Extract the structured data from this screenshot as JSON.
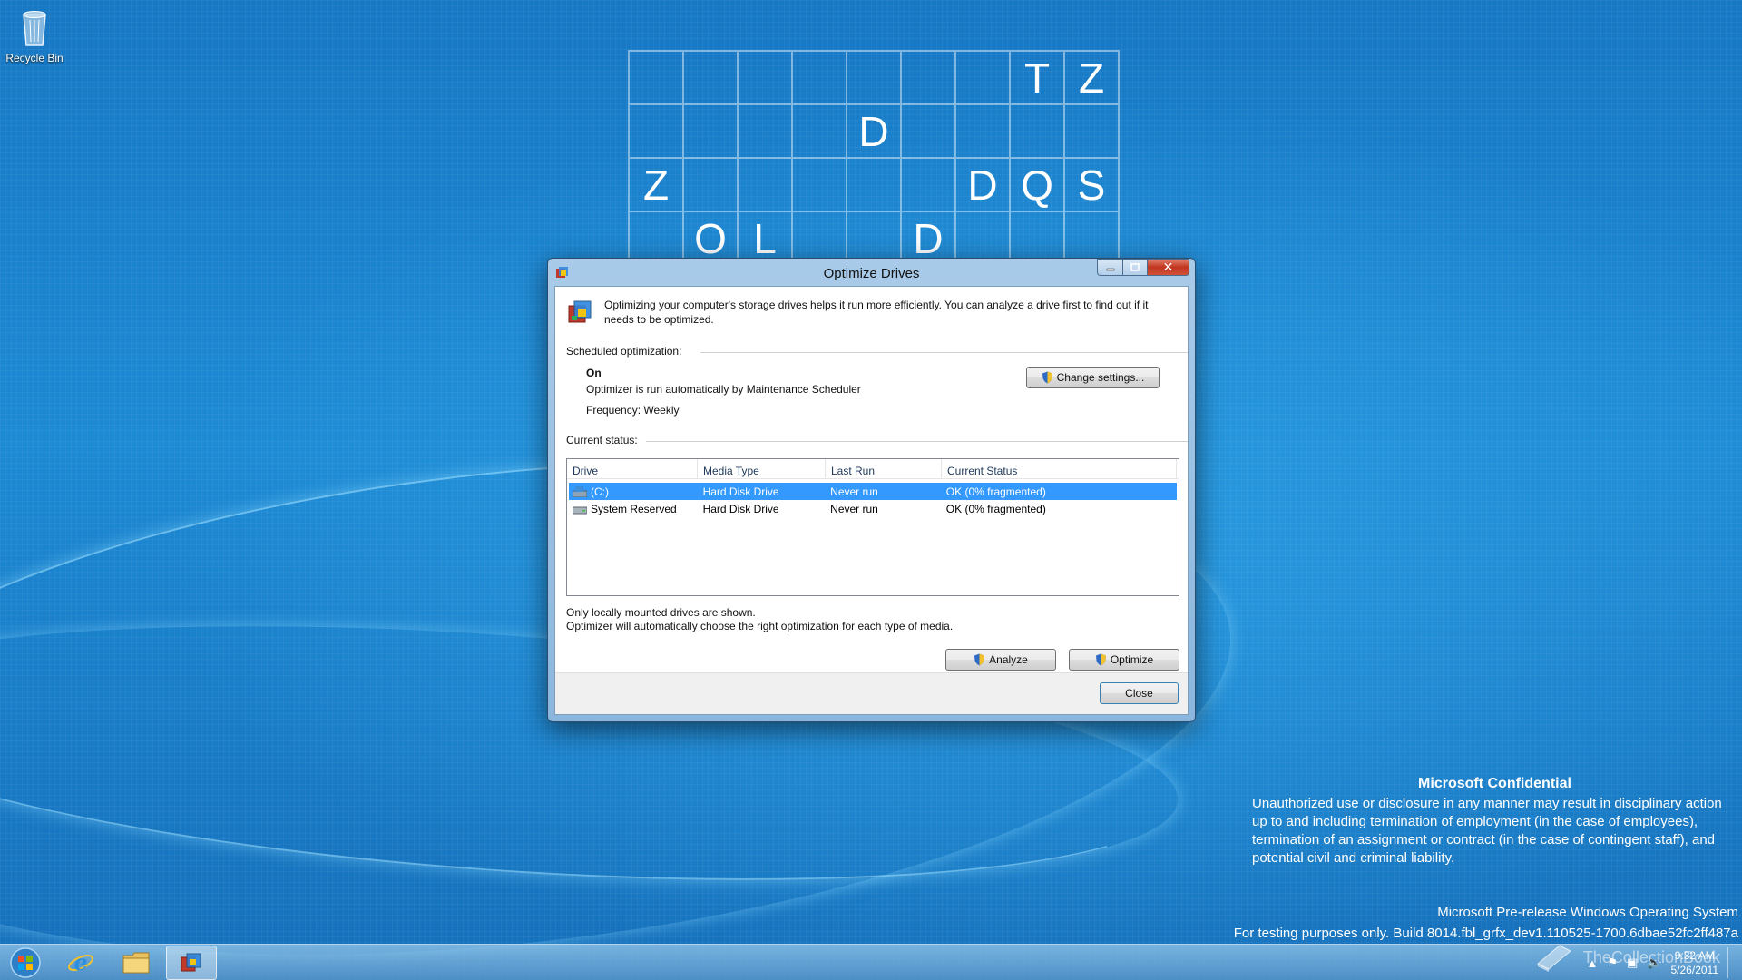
{
  "desktop": {
    "recycle_bin_label": "Recycle Bin",
    "letter_grid": [
      [
        "",
        "",
        "",
        "",
        "",
        "",
        "",
        "T",
        "Z"
      ],
      [
        "",
        "",
        "",
        "",
        "D",
        "",
        "",
        "",
        ""
      ],
      [
        "Z",
        "",
        "",
        "",
        "",
        "",
        "D",
        "Q",
        "S"
      ],
      [
        "",
        "O",
        "L",
        "",
        "",
        "D",
        "",
        "",
        ""
      ]
    ],
    "confidential_title": "Microsoft Confidential",
    "confidential_text": "Unauthorized use or disclosure in any manner may result in disciplinary action up to and including termination of employment (in the case of employees), termination of an assignment or contract (in the case of contingent staff), and potential civil and criminal liability.",
    "build_line1": "Microsoft Pre-release Windows Operating System",
    "build_line2": "For testing purposes only. Build 8014.fbl_grfx_dev1.110525-1700.6dbae52fc2ff487a",
    "watermark": "TheCollectionBook"
  },
  "window": {
    "title": "Optimize Drives",
    "intro": "Optimizing your computer's storage drives helps it run more efficiently. You can analyze a drive first to find out if it needs to be optimized.",
    "scheduled_label": "Scheduled optimization:",
    "schedule_state": "On",
    "schedule_desc": "Optimizer is run automatically by Maintenance Scheduler",
    "frequency": "Frequency: Weekly",
    "change_settings_label": "Change settings...",
    "current_status_label": "Current status:",
    "columns": [
      "Drive",
      "Media Type",
      "Last Run",
      "Current Status"
    ],
    "rows": [
      {
        "drive": "(C:)",
        "media": "Hard Disk Drive",
        "last_run": "Never run",
        "status": "OK (0% fragmented)"
      },
      {
        "drive": "System Reserved",
        "media": "Hard Disk Drive",
        "last_run": "Never run",
        "status": "OK (0% fragmented)"
      }
    ],
    "note1": "Only locally mounted drives are shown.",
    "note2": "Optimizer will automatically choose the right optimization for each type of media.",
    "analyze_label": "Analyze",
    "optimize_label": "Optimize",
    "close_label": "Close"
  },
  "taskbar": {
    "clock_time": "9:32 AM",
    "clock_date": "5/26/2011"
  },
  "colors": {
    "selection": "#3399ff",
    "close_button": "#c2351f",
    "desktop_blue": "#1d8ad4"
  }
}
